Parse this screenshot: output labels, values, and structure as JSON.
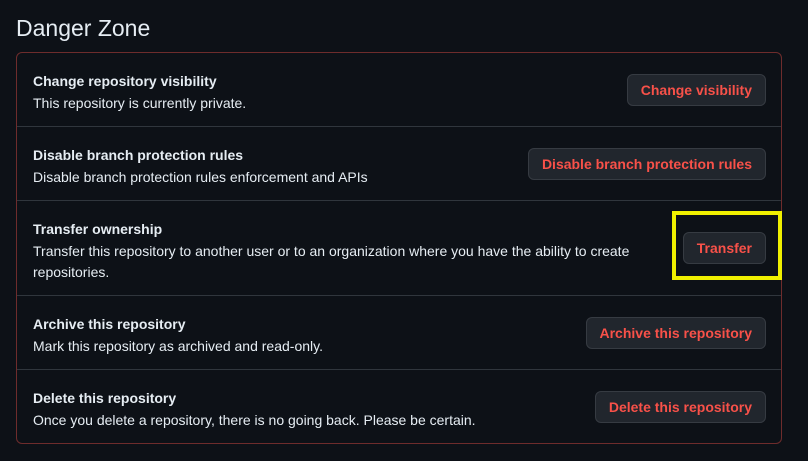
{
  "section": {
    "title": "Danger Zone"
  },
  "rows": [
    {
      "heading": "Change repository visibility",
      "description": "This repository is currently private.",
      "button_label": "Change visibility"
    },
    {
      "heading": "Disable branch protection rules",
      "description": "Disable branch protection rules enforcement and APIs",
      "button_label": "Disable branch protection rules"
    },
    {
      "heading": "Transfer ownership",
      "description_line1": "Transfer this repository to another user or to an organization where you have the ability to create",
      "description_line2": "repositories.",
      "button_label": "Transfer"
    },
    {
      "heading": "Archive this repository",
      "description": "Mark this repository as archived and read-only.",
      "button_label": "Archive this repository"
    },
    {
      "heading": "Delete this repository",
      "description": "Once you delete a repository, there is no going back. Please be certain.",
      "button_label": "Delete this repository"
    }
  ],
  "colors": {
    "background": "#0d1117",
    "danger_border": "#6e2c2c",
    "danger_text": "#f85149",
    "button_bg": "#21262d",
    "highlight": "#f0f000"
  }
}
